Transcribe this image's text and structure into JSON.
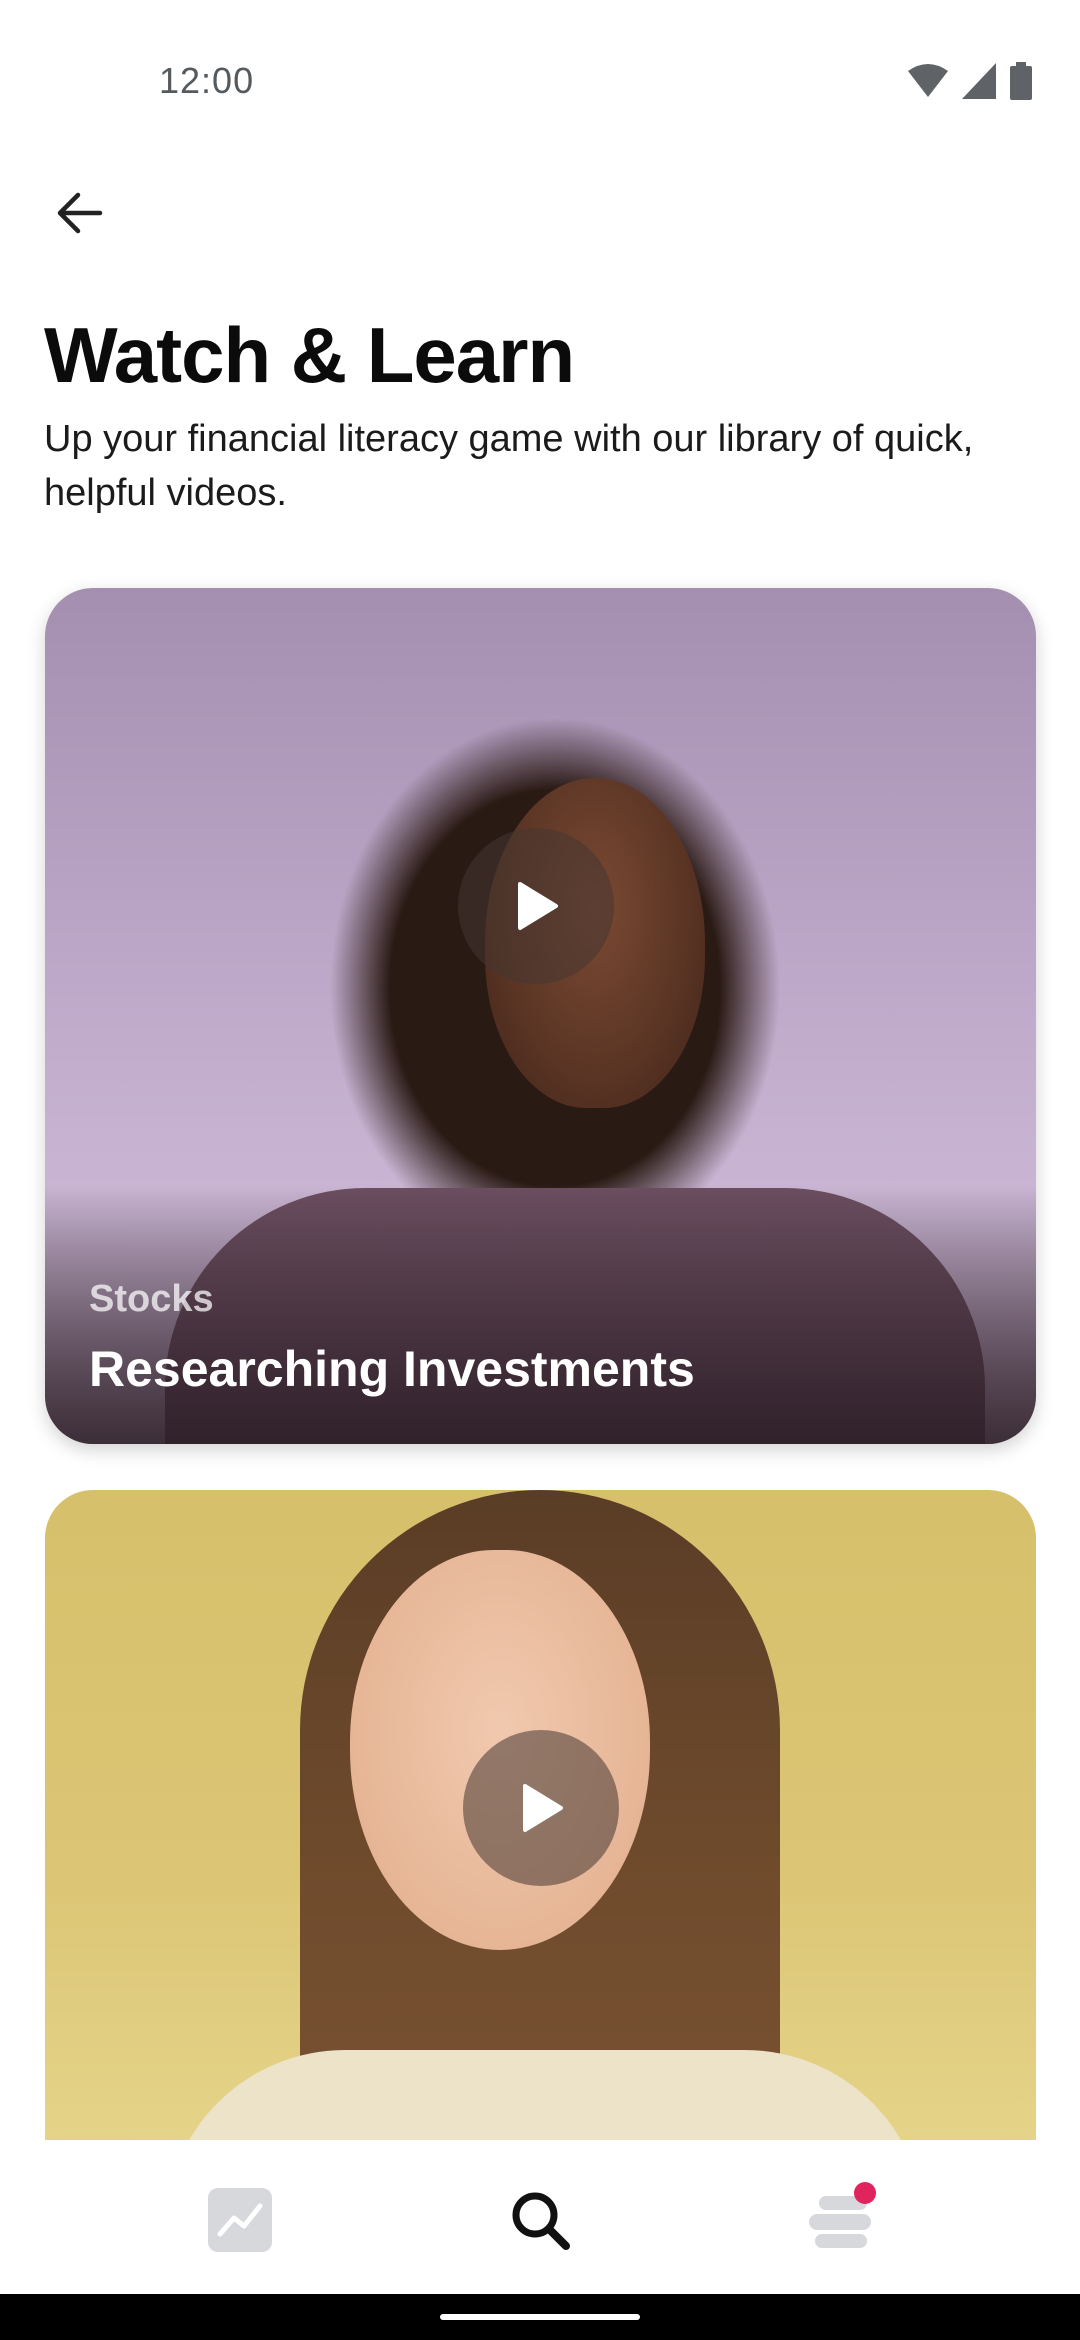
{
  "status_bar": {
    "time": "12:00",
    "icons": [
      "wifi-icon",
      "cellular-signal-icon",
      "battery-icon"
    ]
  },
  "header": {
    "back_icon": "arrow-left-icon",
    "title": "Watch & Learn",
    "subtitle": "Up your financial literacy game with our library of quick, helpful videos."
  },
  "videos": [
    {
      "category": "Stocks",
      "title": "Researching Investments",
      "play_icon": "play-icon"
    },
    {
      "category": "",
      "title": "",
      "play_icon": "play-icon"
    }
  ],
  "bottom_nav": {
    "items": [
      {
        "icon": "chart-line-icon",
        "active": false
      },
      {
        "icon": "search-icon",
        "active": true
      },
      {
        "icon": "activity-stack-icon",
        "active": false,
        "has_notification": true
      }
    ]
  },
  "colors": {
    "accent": "#e0245e",
    "text_primary": "#0b0b0b",
    "nav_inactive": "#d7d8dc"
  }
}
